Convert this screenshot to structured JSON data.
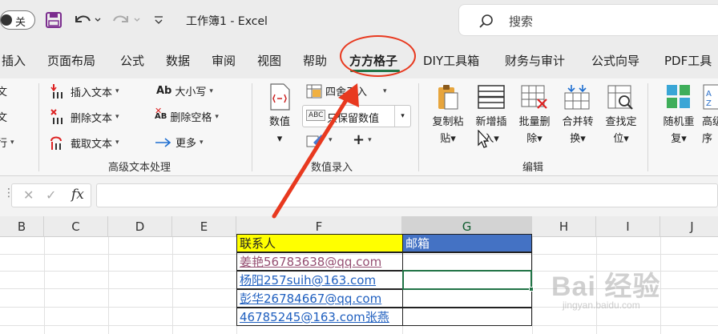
{
  "titlebar": {
    "autosave_label": "关",
    "title": "工作簿1  -  Excel",
    "search_placeholder": "搜索"
  },
  "tabs": [
    {
      "label": "插入"
    },
    {
      "label": "页面布局"
    },
    {
      "label": "公式"
    },
    {
      "label": "数据"
    },
    {
      "label": "审阅"
    },
    {
      "label": "视图"
    },
    {
      "label": "帮助"
    },
    {
      "label": "方方格子"
    },
    {
      "label": "DIY工具箱"
    },
    {
      "label": "财务与审计"
    },
    {
      "label": "公式向导"
    },
    {
      "label": "PDF工具"
    }
  ],
  "active_tab": "方方格子",
  "ribbon": {
    "left_clip": [
      "文",
      "文",
      "行"
    ],
    "text_group": {
      "insert_text": "插入文本",
      "delete_text": "删除文本",
      "extract_text": "截取文本",
      "case_prefix": "Ab",
      "case": "大小写",
      "delete_space_prefix": "AB",
      "delete_space": "删除空格",
      "more": "更多",
      "label": "高级文本处理"
    },
    "number_group": {
      "value_btn": "数值",
      "round": "四舍五入",
      "keep_value_badge": "ABC",
      "keep_value": "只保留数值",
      "plus": "+",
      "label": "数值录入"
    },
    "edit_group": {
      "copy_paste": [
        "复制粘",
        "贴"
      ],
      "insert_new": [
        "新增插",
        "入"
      ],
      "batch_delete": [
        "批量删",
        "除"
      ],
      "merge_convert": [
        "合并转",
        "换"
      ],
      "find_locate": [
        "查找定",
        "位"
      ],
      "label": "编辑"
    },
    "extra": {
      "random_repeat": [
        "随机重",
        "复"
      ],
      "advanced_sort": [
        "高级",
        "序"
      ]
    }
  },
  "formula_bar": {
    "cancel": "✕",
    "confirm": "✓",
    "fx": "fx",
    "value": ""
  },
  "columns": [
    "B",
    "C",
    "D",
    "E",
    "F",
    "G",
    "H",
    "I",
    "J"
  ],
  "selected_column": "G",
  "table": {
    "header_contact": "联系人",
    "header_email": "邮箱",
    "rows": [
      "姜艳56783638@qq.com",
      "杨阳257suih@163.com",
      "彭华26784667@qq.com",
      "46785245@163.com张燕"
    ]
  },
  "watermark": {
    "brand": "Bai  经验",
    "url": "jingyan.baidu.com"
  },
  "colors": {
    "excel_green": "#217346",
    "annotation_red": "#e8391f",
    "header_yellow": "#ffff00",
    "header_blue": "#4472c4",
    "link_blue": "#1f5fbf"
  }
}
